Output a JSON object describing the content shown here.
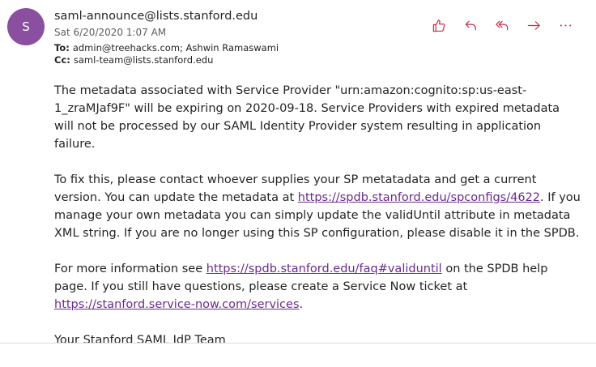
{
  "message": {
    "avatar_initial": "S",
    "sender": "saml-announce@lists.stanford.edu",
    "date": "Sat 6/20/2020 1:07 AM",
    "to_label": "To:",
    "to": "admin@treehacks.com; Ashwin Ramaswami",
    "cc_label": "Cc:",
    "cc": "saml-team@lists.stanford.edu"
  },
  "actions": {
    "like_icon": "thumbs-up-icon",
    "reply_icon": "reply-icon",
    "reply_all_icon": "reply-all-icon",
    "forward_icon": "forward-icon",
    "more_icon": "more-actions-icon",
    "accent_color": "#c4314b"
  },
  "body": {
    "p1": "The metadata associated with Service Provider \"urn:amazon:cognito:sp:us-east-1_zraMJaf9F\" will be expiring on 2020-09-18. Service Providers with expired metadata will not be processed by our SAML Identity Provider system resulting in application failure.",
    "p2_a": "To fix this, please contact whoever supplies your SP metatadata and get a current version. You can update the metadata at ",
    "p2_link": "https://spdb.stanford.edu/spconfigs/4622",
    "p2_b": ". If you manage your own metadata you can simply update the validUntil attribute in metadata XML string. If you are no longer using this SP configuration, please disable it in the SPDB.",
    "p3_a": "For more information see ",
    "p3_link1": "https://spdb.stanford.edu/faq#validuntil",
    "p3_b": " on the SPDB help page. If you still have questions, please create a Service Now ticket at ",
    "p3_link2": "https://stanford.service-now.com/services",
    "p3_c": ".",
    "signature": "Your Stanford SAML IdP Team"
  }
}
